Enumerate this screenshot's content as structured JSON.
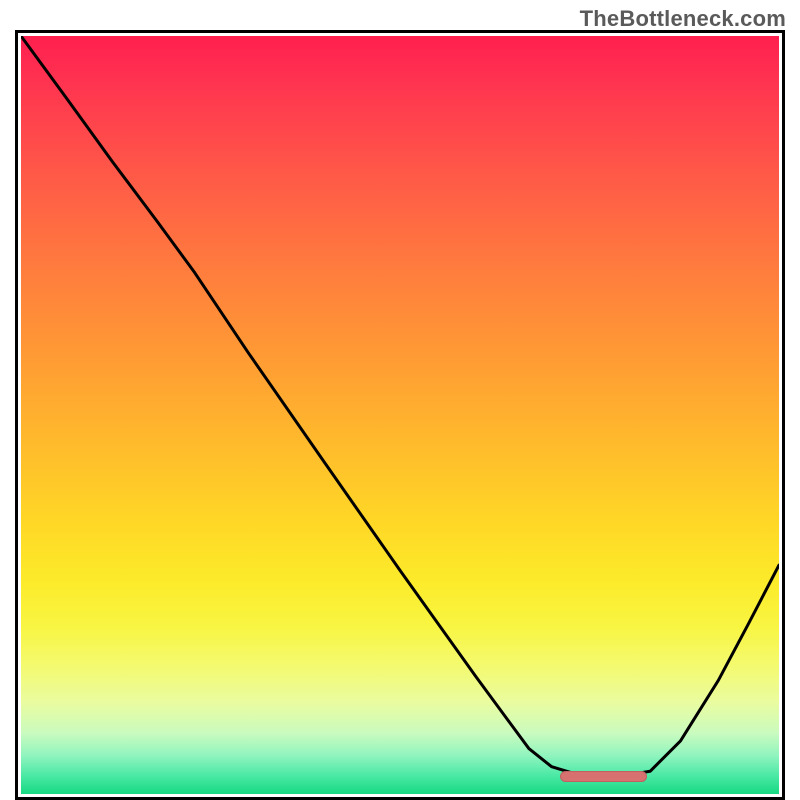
{
  "watermark": {
    "text": "TheBottleneck.com"
  },
  "colors": {
    "border": "#000000",
    "curve": "#000000",
    "marker": "#d6716f",
    "gradient_top": "#ff1f4f",
    "gradient_bottom": "#16d982"
  },
  "marker": {
    "x_start_frac": 0.706,
    "x_end_frac": 0.82,
    "y_frac": 0.968
  },
  "chart_data": {
    "type": "line",
    "title": "",
    "xlabel": "",
    "ylabel": "",
    "xlim": [
      0,
      1
    ],
    "ylim": [
      0,
      1
    ],
    "annotations": [
      "TheBottleneck.com"
    ],
    "series": [
      {
        "name": "curve",
        "x": [
          0.0,
          0.06,
          0.12,
          0.18,
          0.229,
          0.3,
          0.4,
          0.5,
          0.6,
          0.67,
          0.7,
          0.73,
          0.76,
          0.8,
          0.83,
          0.87,
          0.92,
          0.96,
          1.0
        ],
        "y": [
          1.0,
          0.918,
          0.835,
          0.755,
          0.688,
          0.582,
          0.438,
          0.295,
          0.155,
          0.06,
          0.036,
          0.027,
          0.025,
          0.025,
          0.03,
          0.07,
          0.15,
          0.225,
          0.302
        ]
      }
    ],
    "marker": {
      "shape": "pill",
      "x_range": [
        0.706,
        0.82
      ],
      "y": 0.032
    }
  }
}
